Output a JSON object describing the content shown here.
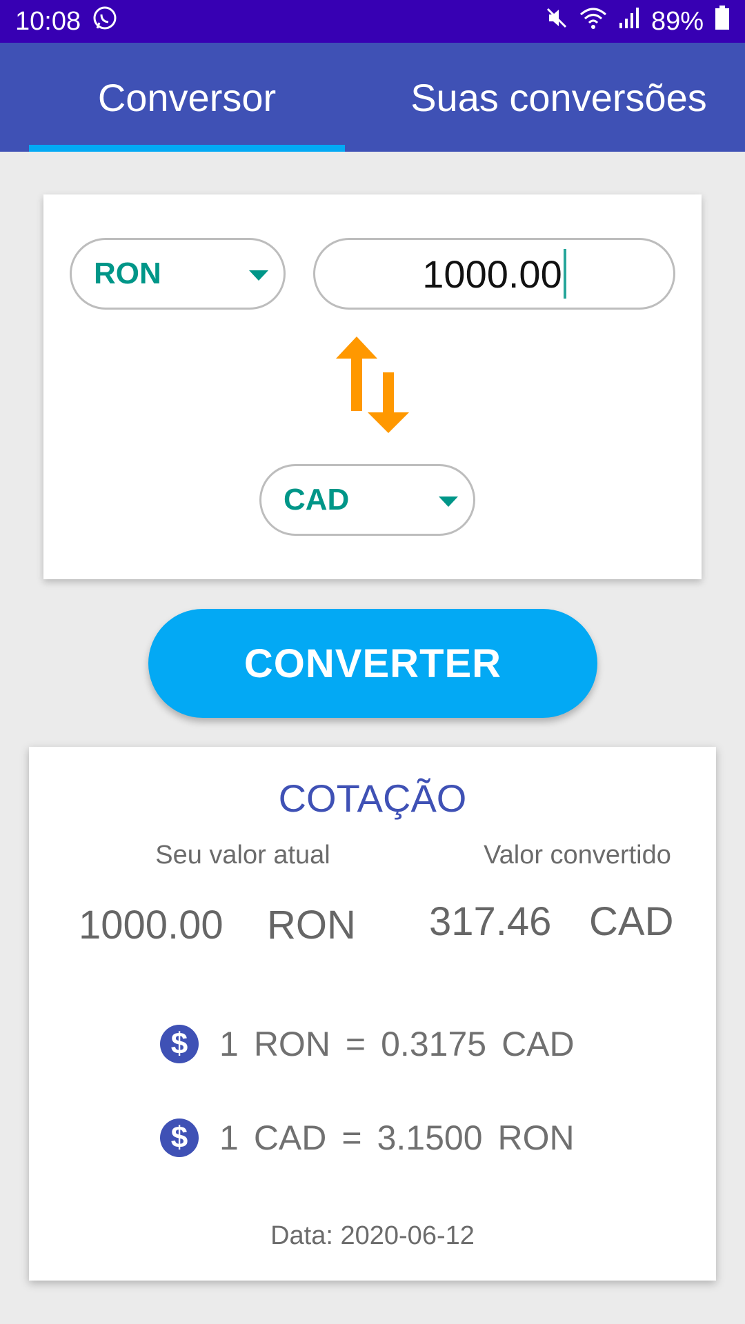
{
  "status_bar": {
    "time": "10:08",
    "battery": "89%",
    "icons": [
      "whatsapp-icon",
      "mute-icon",
      "wifi-icon",
      "signal-icon",
      "battery-icon"
    ]
  },
  "tabs": [
    {
      "label": "Conversor",
      "selected": true
    },
    {
      "label": "Suas conversões",
      "selected": false
    }
  ],
  "converter": {
    "from_currency": "RON",
    "amount": "1000.00",
    "to_currency": "CAD",
    "swap_icon": "swap-vertical-arrows-icon"
  },
  "convert_button": {
    "label": "CONVERTER"
  },
  "rate_card": {
    "title": "COTAÇÃO",
    "current_label": "Seu valor atual",
    "converted_label": "Valor convertido",
    "current_value": "1000.00",
    "current_currency": "RON",
    "converted_value": "317.46",
    "converted_currency": "CAD",
    "rates": [
      {
        "one": "1",
        "from": "RON",
        "eq": "=",
        "rate": "0.3175",
        "to": "CAD"
      },
      {
        "one": "1",
        "from": "CAD",
        "eq": "=",
        "rate": "3.1500",
        "to": "RON"
      }
    ],
    "date": "Data: 2020-06-12"
  },
  "colors": {
    "status_bar": "#3700b3",
    "app_bar": "#3f51b5",
    "accent": "#03a9f4",
    "currency_text": "#009688",
    "swap_arrows": "#ff9800"
  }
}
